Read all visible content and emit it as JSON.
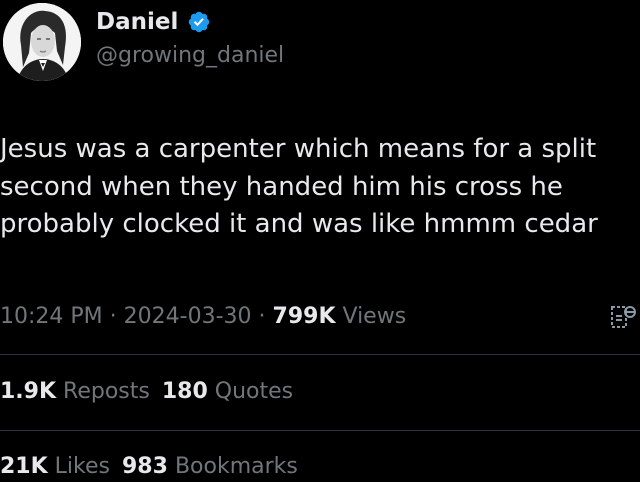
{
  "author": {
    "display_name": "Daniel",
    "handle": "@growing_daniel",
    "avatar_icon": "profile-photo",
    "verified_icon": "verified-badge-icon",
    "verified_color": "#1d9bf0"
  },
  "tweet": {
    "lines": [
      "Jesus was a carpenter which means for a split",
      "second when they handed him his cross he",
      "probably clocked it and was like hmmm cedar"
    ]
  },
  "meta": {
    "time": "10:24 PM",
    "separator": "·",
    "date": "2024-03-30",
    "views_count": "799K",
    "views_label": "Views",
    "stats_icon": "analytics-icon"
  },
  "engagement": {
    "reposts_count": "1.9K",
    "reposts_label": "Reposts",
    "quotes_count": "180",
    "quotes_label": "Quotes",
    "likes_count": "21K",
    "likes_label": "Likes",
    "bookmarks_count": "983",
    "bookmarks_label": "Bookmarks"
  },
  "colors": {
    "background": "#000000",
    "primary_text": "#e7e9ea",
    "secondary_text": "#71767b",
    "divider": "#2f3336",
    "accent": "#1d9bf0"
  }
}
